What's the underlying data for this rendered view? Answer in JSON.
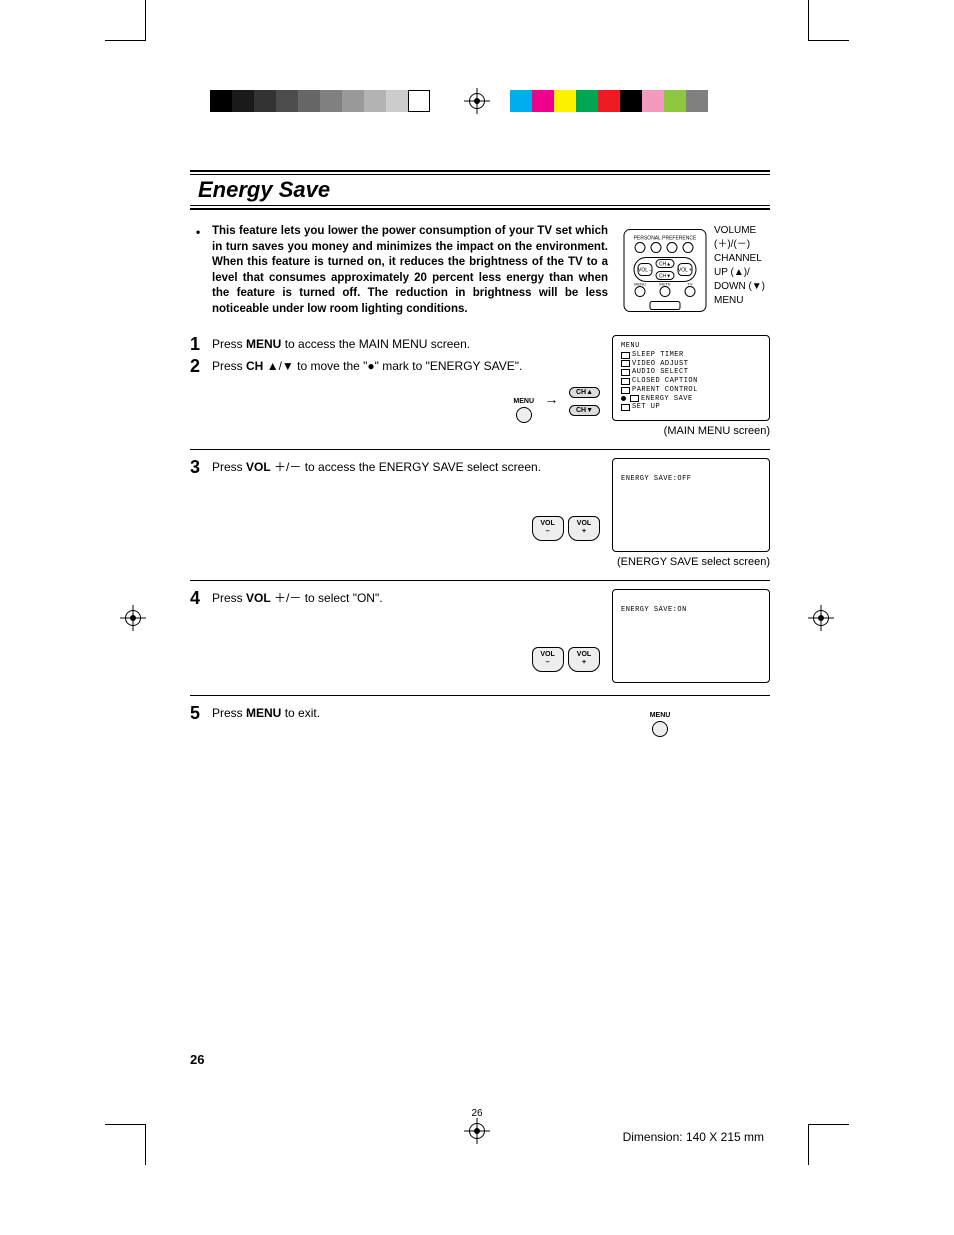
{
  "title": "Energy Save",
  "intro": "This feature lets you lower the power consumption of your TV set which in turn saves you money and minimizes the impact on the environment. When this feature is turned on, it reduces the brightness of the TV to a level that consumes approximately 20 percent less energy than when the feature is turned off. The reduction in brightness will be less noticeable under low room lighting conditions.",
  "remote_labels": {
    "volume": "VOLUME",
    "volume_sym": "(＋)/(－)",
    "channel": "CHANNEL",
    "ch_up": "UP (▲)/",
    "ch_down": "DOWN (▼)",
    "menu": "MENU"
  },
  "steps": {
    "s1": {
      "num": "1",
      "pre": "Press ",
      "bold": "MENU",
      "post": " to access the MAIN MENU screen."
    },
    "s2": {
      "num": "2",
      "pre": "Press ",
      "bold": "CH",
      "mid": " ▲/▼ to move the \"●\" mark to \"ENERGY SAVE\"."
    },
    "s3": {
      "num": "3",
      "pre": "Press ",
      "bold": "VOL",
      "post": " ＋/－ to access the ENERGY SAVE select screen."
    },
    "s4": {
      "num": "4",
      "pre": "Press ",
      "bold": "VOL",
      "post": " ＋/－ to select \"ON\"."
    },
    "s5": {
      "num": "5",
      "pre": "Press ",
      "bold": "MENU",
      "post": " to exit."
    }
  },
  "buttons": {
    "menu": "MENU",
    "ch_up": "CH▲",
    "ch_down": "CH▼",
    "vol_minus_top": "VOL",
    "vol_minus_bot": "–",
    "vol_plus_top": "VOL",
    "vol_plus_bot": "+"
  },
  "main_menu": {
    "header": "MENU",
    "items": [
      "SLEEP TIMER",
      "VIDEO ADJUST",
      "AUDIO SELECT",
      "CLOSED CAPTION",
      "PARENT CONTROL",
      "ENERGY SAVE",
      "SET UP"
    ],
    "caption": "(MAIN MENU screen)"
  },
  "es_off": {
    "text": "ENERGY SAVE:OFF",
    "caption": "(ENERGY SAVE select screen)"
  },
  "es_on": {
    "text": "ENERGY SAVE:ON"
  },
  "page_big": "26",
  "page_small": "26",
  "dimension": "Dimension: 140  X 215 mm",
  "grays": [
    "#000",
    "#1a1a1a",
    "#333",
    "#4d4d4d",
    "#666",
    "#808080",
    "#999",
    "#b3b3b3",
    "#ccc",
    "#fff"
  ],
  "colors": [
    "#00aeef",
    "#ec008c",
    "#fff200",
    "#00a651",
    "#ed1c24",
    "#000000",
    "#f49ac1",
    "#8dc63f",
    "#808080"
  ]
}
